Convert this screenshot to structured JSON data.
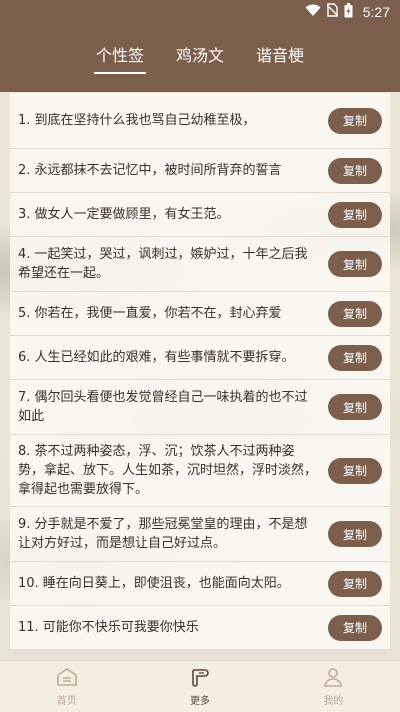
{
  "status_bar": {
    "time": "5:27",
    "icons": [
      "wifi-icon",
      "no-sim-icon",
      "battery-icon"
    ]
  },
  "tabs": [
    {
      "label": "个性签",
      "active": true
    },
    {
      "label": "鸡汤文",
      "active": false
    },
    {
      "label": "谐音梗",
      "active": false
    }
  ],
  "colors": {
    "header_bg": "#7b5e4c",
    "button_bg": "#7b5e4c",
    "page_bg": "#efe6d8"
  },
  "copy_label": "复制",
  "items": [
    "1. 到底在坚持什么我也骂自己幼稚至极，",
    "2. 永远都抹不去记忆中，被时间所背弃的誓言",
    "3. 做女人一定要做顾里，有女王范。",
    "4. 一起笑过，哭过，讽刺过，嫉妒过，十年之后我希望还在一起。",
    "5. 你若在，我便一直爱，你若不在，封心弃爱",
    "6. 人生已经如此的艰难，有些事情就不要拆穿。",
    "7. 偶尔回头看便也发觉曾经自己一味执着的也不过如此",
    "8. 茶不过两种姿态，浮、沉；饮茶人不过两种姿势，拿起、放下。人生如茶，沉时坦然，浮时淡然，拿得起也需要放得下。",
    "9. 分手就是不爱了，那些冠冕堂皇的理由，不是想让对方好过，而是想让自己好过点。",
    "10. 睡在向日葵上，即使沮丧，也能面向太阳。",
    "11. 可能你不快乐可我要你快乐"
  ],
  "bottom_nav": [
    {
      "label": "首页",
      "icon": "home-icon",
      "active": false
    },
    {
      "label": "更多",
      "icon": "scroll-icon",
      "active": true
    },
    {
      "label": "我的",
      "icon": "person-icon",
      "active": false
    }
  ]
}
